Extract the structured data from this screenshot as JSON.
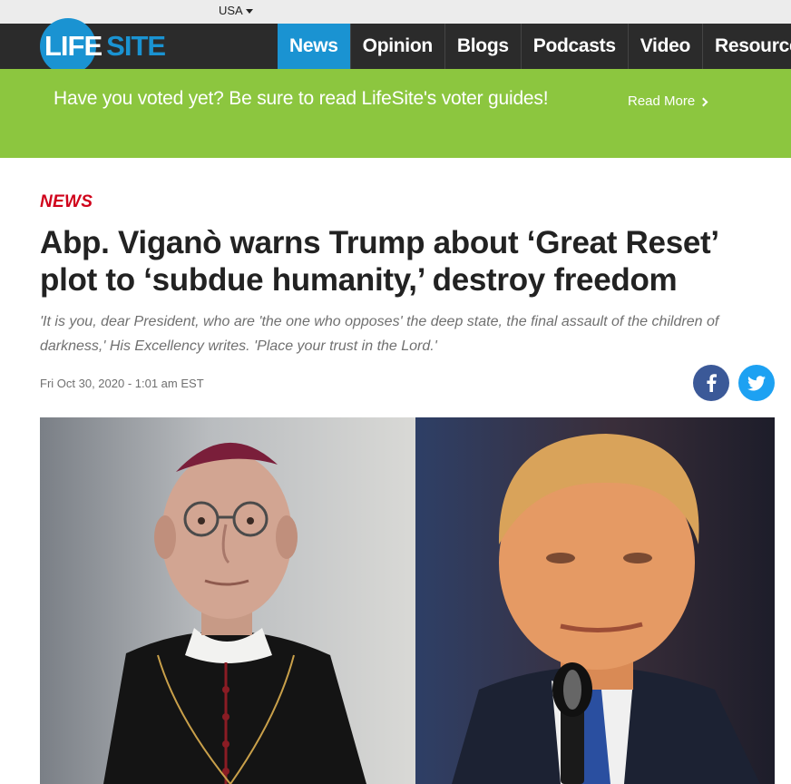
{
  "topbar": {
    "country": "USA"
  },
  "nav": {
    "logo_life": "LIFE",
    "logo_site": "SITE",
    "items": [
      {
        "label": "News",
        "active": true
      },
      {
        "label": "Opinion"
      },
      {
        "label": "Blogs"
      },
      {
        "label": "Podcasts"
      },
      {
        "label": "Video"
      },
      {
        "label": "Resources"
      }
    ]
  },
  "promo": {
    "text": "Have you voted yet? Be sure to read LifeSite's voter guides!",
    "link": "Read More"
  },
  "article": {
    "kicker": "NEWS",
    "headline": "Abp. Viganò warns Trump about ‘Great Reset’ plot to ‘subdue humanity,’ destroy freedom",
    "dek": "'It is you, dear President, who are 'the one who opposes' the deep state, the final assault of the children of darkness,' His Excellency writes. 'Place your trust in the Lord.'",
    "dateline": "Fri Oct 30, 2020 - 1:01 am EST"
  },
  "share": {
    "facebook_icon": "facebook-icon",
    "twitter_icon": "twitter-icon"
  },
  "colors": {
    "brand_blue": "#1a93d2",
    "promo_green": "#8cc63f",
    "kicker_red": "#d0021b",
    "nav_dark": "#2b2b2b"
  }
}
